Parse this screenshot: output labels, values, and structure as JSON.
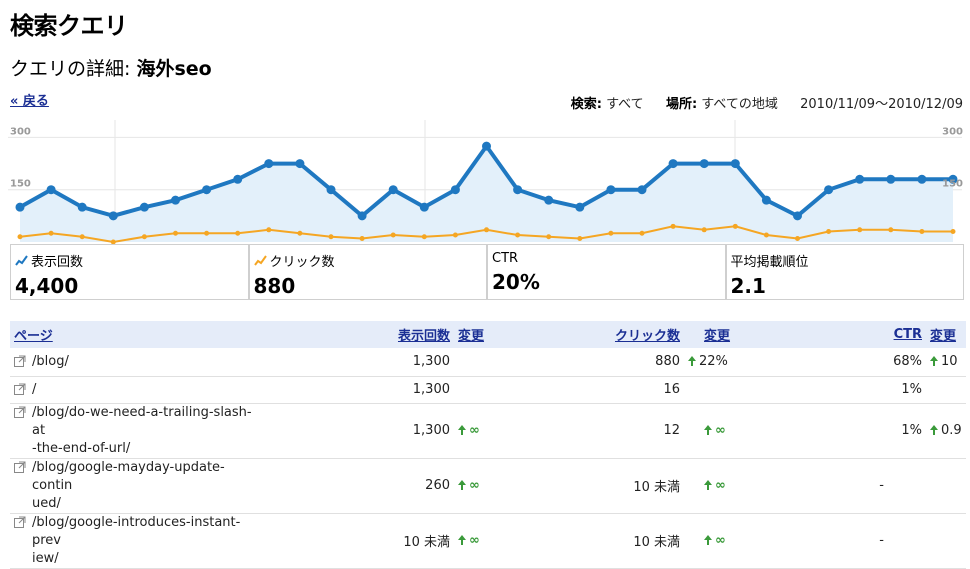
{
  "header": {
    "title": "検索クエリ",
    "detail_label": "クエリの詳細:",
    "query": "海外seo"
  },
  "nav": {
    "back": "« 戻る"
  },
  "filters": {
    "search_label": "検索:",
    "search_value": "すべて",
    "location_label": "場所:",
    "location_value": "すべての地域",
    "date_range": "2010/11/09～2010/12/09"
  },
  "chart_data": {
    "type": "line",
    "y_ticks": [
      "300",
      "150"
    ],
    "ylim": [
      0,
      350
    ],
    "grid": true,
    "series": [
      {
        "name": "表示回数",
        "color": "#1f78c1",
        "values": [
          100,
          150,
          100,
          75,
          100,
          120,
          150,
          180,
          225,
          225,
          150,
          75,
          150,
          100,
          150,
          275,
          150,
          120,
          100,
          150,
          150,
          225,
          225,
          225,
          120,
          75,
          150,
          180,
          180,
          180,
          180
        ]
      },
      {
        "name": "クリック数",
        "color": "#f5a623",
        "values": [
          15,
          25,
          15,
          0,
          15,
          25,
          25,
          25,
          35,
          25,
          15,
          10,
          20,
          15,
          20,
          35,
          20,
          15,
          10,
          25,
          25,
          45,
          35,
          45,
          20,
          10,
          30,
          35,
          35,
          30,
          30
        ]
      }
    ]
  },
  "metrics": [
    {
      "label": "表示回数",
      "value": "4,400",
      "icon": "impressions-sparkline-icon"
    },
    {
      "label": "クリック数",
      "value": "880",
      "icon": "clicks-sparkline-icon"
    },
    {
      "label": "CTR",
      "value": "20%"
    },
    {
      "label": "平均掲載順位",
      "value": "2.1"
    }
  ],
  "table": {
    "headers": {
      "page": "ページ",
      "impressions": "表示回数",
      "imp_change": "変更",
      "clicks": "クリック数",
      "clk_change": "変更",
      "ctr": "CTR",
      "ctr_change": "変更"
    },
    "rows": [
      {
        "page": "/blog/",
        "impressions": "1,300",
        "imp_change": "",
        "clicks": "880",
        "clk_change": "22%",
        "ctr": "68%",
        "ctr_change": "10"
      },
      {
        "page": "/",
        "impressions": "1,300",
        "imp_change": "",
        "clicks": "16",
        "clk_change": "",
        "ctr": "1%",
        "ctr_change": ""
      },
      {
        "page": "/blog/do-we-need-a-trailing-slash-at-the-end-of-url/",
        "page_l1": "/blog/do-we-need-a-trailing-slash-at",
        "page_l2": "-the-end-of-url/",
        "impressions": "1,300",
        "imp_change": "∞",
        "clicks": "12",
        "clk_change": "∞",
        "ctr": "1%",
        "ctr_change": "0.9"
      },
      {
        "page": "/blog/google-mayday-update-continued/",
        "page_l1": "/blog/google-mayday-update-contin",
        "page_l2": "ued/",
        "impressions": "260",
        "imp_change": "∞",
        "clicks": "10 未満",
        "clk_change": "∞",
        "ctr": "-",
        "ctr_change": ""
      },
      {
        "page": "/blog/google-introduces-instant-preview/",
        "page_l1": "/blog/google-introduces-instant-prev",
        "page_l2": "iew/",
        "impressions": "10 未満",
        "imp_change": "∞",
        "clicks": "10 未満",
        "clk_change": "∞",
        "ctr": "-",
        "ctr_change": ""
      }
    ]
  }
}
